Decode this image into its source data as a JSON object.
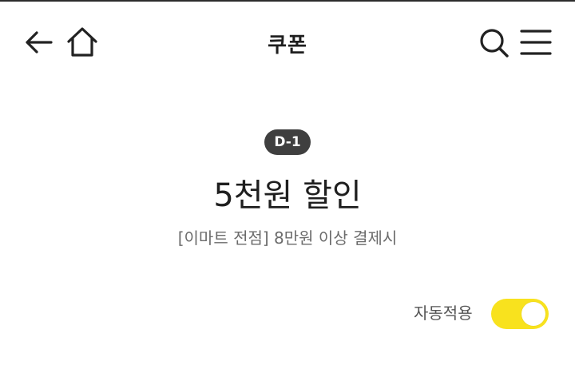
{
  "header": {
    "title": "쿠폰",
    "icons": {
      "back": "arrow-left-icon",
      "home": "home-icon",
      "search": "search-icon",
      "menu": "hamburger-menu-icon"
    }
  },
  "coupon": {
    "badge": "D-1",
    "title": "5천원 할인",
    "description": "[이마트 전점] 8만원 이상 결제시"
  },
  "auto_apply": {
    "label": "자동적용",
    "enabled": true
  },
  "colors": {
    "toggle_on": "#f8e21e",
    "badge_bg": "#3f3f3f",
    "text_primary": "#1f1f1f",
    "text_secondary": "#6b6b6b"
  }
}
